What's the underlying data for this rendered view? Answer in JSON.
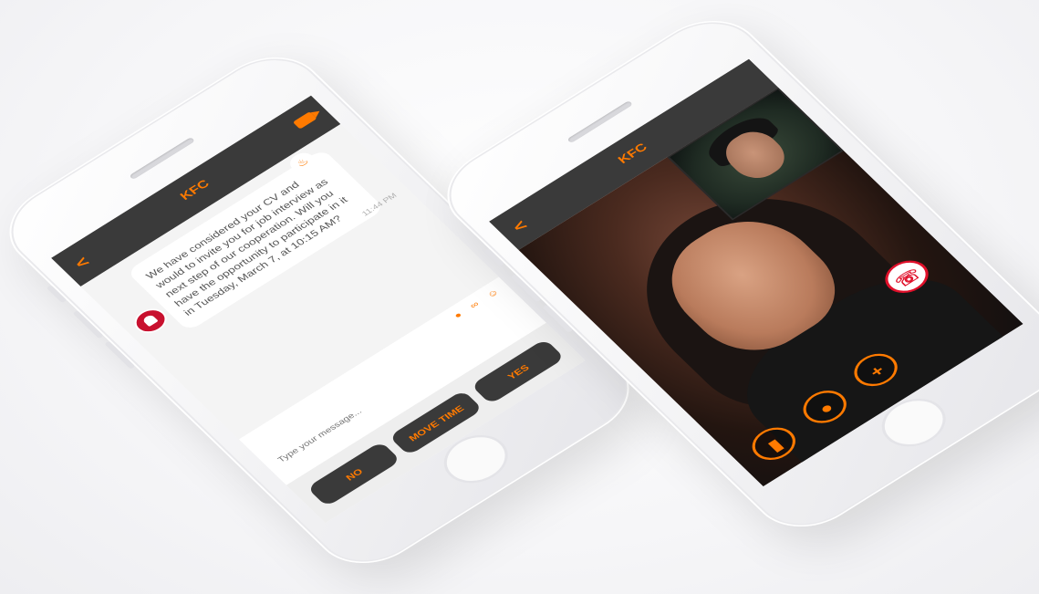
{
  "chat_screen": {
    "title": "KFC",
    "back_glyph": "<",
    "message": "We have considered your CV and would to invite you for job interview as next step of our cooperation. Will you have the opportunity to participate in it in Tuesday, March 7, at 10:15 AM?",
    "time": "11:44 PM",
    "input_placeholder": "Type your message...",
    "buttons": {
      "no": "NO",
      "move_time": "MOVE TIME",
      "yes": "YES"
    },
    "accent_color": "#ff7a00"
  },
  "call_screen": {
    "title": "KFC",
    "back_glyph": "<",
    "add_glyph": "+",
    "controls": [
      "video-icon",
      "mic-icon",
      "add-icon",
      "end-call-icon"
    ]
  }
}
